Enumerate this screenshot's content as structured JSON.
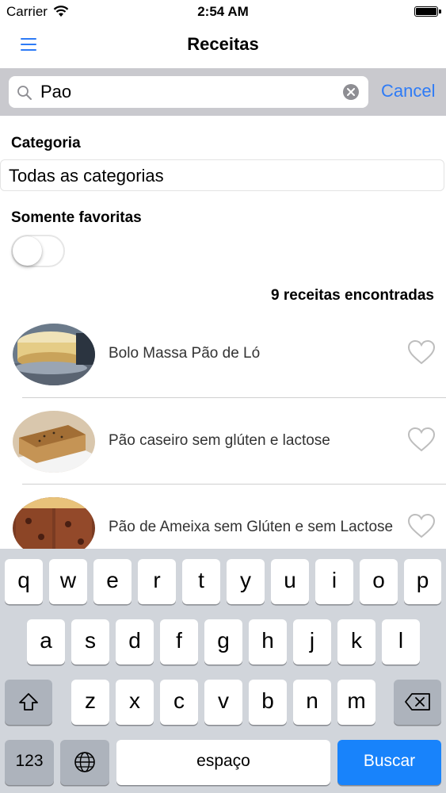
{
  "status": {
    "carrier": "Carrier",
    "time": "2:54 AM"
  },
  "nav": {
    "title": "Receitas",
    "menu_icon": "hamburger-icon"
  },
  "search": {
    "value": "Pao",
    "cancel_label": "Cancel"
  },
  "filters": {
    "category_label": "Categoria",
    "category_value": "Todas as categorias",
    "favorites_label": "Somente favoritas",
    "favorites_on": false
  },
  "results": {
    "count_text": "9 receitas encontradas",
    "items": [
      {
        "name": "Bolo Massa Pão de Ló",
        "favorite": false
      },
      {
        "name": "Pão caseiro sem glúten e lactose",
        "favorite": false
      },
      {
        "name": "Pão de Ameixa sem Glúten e sem Lactose",
        "favorite": false
      }
    ]
  },
  "keyboard": {
    "row1": [
      "q",
      "w",
      "e",
      "r",
      "t",
      "y",
      "u",
      "i",
      "o",
      "p"
    ],
    "row2": [
      "a",
      "s",
      "d",
      "f",
      "g",
      "h",
      "j",
      "k",
      "l"
    ],
    "row3": [
      "z",
      "x",
      "c",
      "v",
      "b",
      "n",
      "m"
    ],
    "numbers_label": "123",
    "space_label": "espaço",
    "return_label": "Buscar"
  },
  "colors": {
    "accent": "#2e7bf6",
    "return_key": "#1883fb"
  }
}
